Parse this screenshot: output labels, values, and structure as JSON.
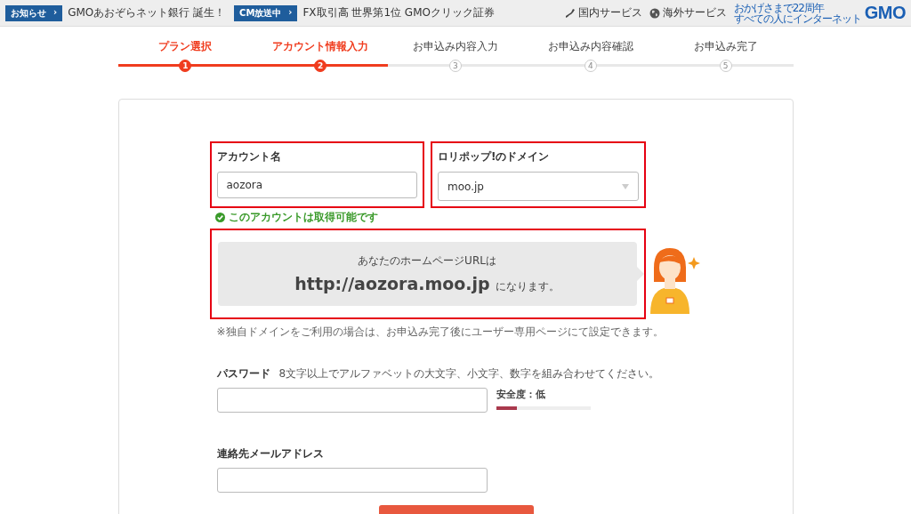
{
  "header": {
    "notices": [
      {
        "badge": "お知らせ",
        "chevron": "›",
        "text": "GMOあおぞらネット銀行 誕生！"
      },
      {
        "badge": "CM放送中",
        "chevron": "›",
        "text": "FX取引高 世界第1位 GMOクリック証券"
      }
    ],
    "links": [
      {
        "label": "国内サービス",
        "kind": "japan"
      },
      {
        "label": "海外サービス",
        "kind": "globe"
      }
    ],
    "logo": {
      "tagline_1": "おかげさまで22周年",
      "tagline_2": "すべての人にインターネット",
      "wordmark": "GMO"
    }
  },
  "steps": [
    {
      "label": "プラン選択",
      "number": "1",
      "done": true
    },
    {
      "label": "アカウント情報入力",
      "number": "2",
      "done": true
    },
    {
      "label": "お申込み内容入力",
      "number": "3",
      "done": false
    },
    {
      "label": "お申込み内容確認",
      "number": "4",
      "done": false
    },
    {
      "label": "お申込み完了",
      "number": "5",
      "done": false
    }
  ],
  "form": {
    "account": {
      "label": "アカウント名",
      "value": "aozora"
    },
    "domain": {
      "label": "ロリポップ!のドメイン",
      "value": "moo.jp"
    },
    "availability": "このアカウントは取得可能です",
    "url_box": {
      "line_1": "あなたのホームページURLは",
      "url": "http://aozora.moo.jp",
      "suffix": "になります。"
    },
    "note": "※独自ドメインをご利用の場合は、お申込み完了後にユーザー専用ページにて設定できます。",
    "password": {
      "label": "パスワード",
      "hint": "8文字以上でアルファベットの大文字、小文字、数字を組み合わせてください。",
      "strength_label": "安全度：低",
      "level": 0.22
    },
    "email": {
      "label": "連絡先メールアドレス"
    }
  }
}
